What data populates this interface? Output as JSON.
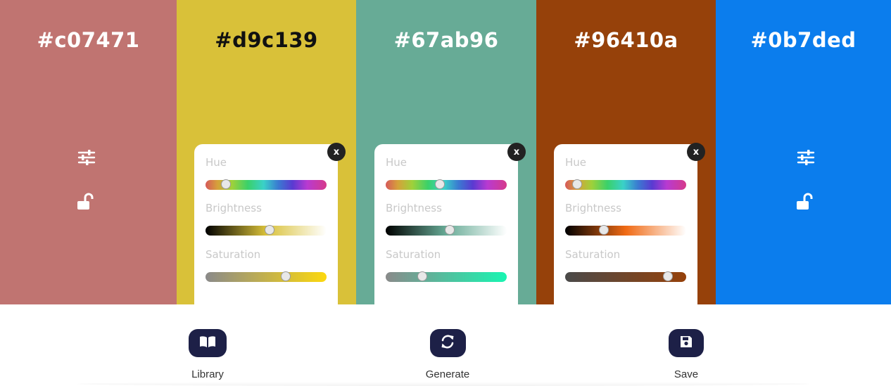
{
  "palette": {
    "columns": [
      {
        "hex": "#c07471",
        "bg": "#c07471",
        "text_color": "#ffffff",
        "state": "collapsed",
        "adjust_icon": "sliders-icon",
        "lock_icon": "unlock-icon",
        "locked": false
      },
      {
        "hex": "#d9c139",
        "bg": "#d9c139",
        "text_color": "#111111",
        "state": "adjusting",
        "panel": {
          "hue_label": "Hue",
          "brightness_label": "Brightness",
          "saturation_label": "Saturation",
          "close_label": "x",
          "hue_value": 0.17,
          "brightness_value": 0.53,
          "saturation_value": 0.66,
          "brightness_colors": [
            "#000000",
            "#d9c139",
            "#ffffff"
          ],
          "saturation_colors": [
            "#8a8a8a",
            "#fcd80f"
          ]
        }
      },
      {
        "hex": "#67ab96",
        "bg": "#67ab96",
        "text_color": "#ffffff",
        "state": "adjusting",
        "panel": {
          "hue_label": "Hue",
          "brightness_label": "Brightness",
          "saturation_label": "Saturation",
          "close_label": "x",
          "hue_value": 0.45,
          "brightness_value": 0.53,
          "saturation_value": 0.3,
          "brightness_colors": [
            "#000000",
            "#67ab96",
            "#ffffff"
          ],
          "saturation_colors": [
            "#8a8a8a",
            "#19f5b2"
          ]
        }
      },
      {
        "hex": "#96410a",
        "bg": "#96410a",
        "text_color": "#ffffff",
        "state": "adjusting",
        "panel": {
          "hue_label": "Hue",
          "brightness_label": "Brightness",
          "saturation_label": "Saturation",
          "close_label": "x",
          "hue_value": 0.1,
          "brightness_value": 0.32,
          "saturation_value": 0.85,
          "brightness_colors": [
            "#000000",
            "#f06a14",
            "#ffffff"
          ],
          "saturation_colors": [
            "#4a4a4a",
            "#96410a"
          ]
        }
      },
      {
        "hex": "#0b7ded",
        "bg": "#0b7ded",
        "text_color": "#ffffff",
        "state": "collapsed",
        "adjust_icon": "sliders-icon",
        "lock_icon": "unlock-icon",
        "locked": false
      }
    ]
  },
  "toolbar": {
    "library_label": "Library",
    "library_icon": "book-icon",
    "generate_label": "Generate",
    "generate_icon": "refresh-icon",
    "save_label": "Save",
    "save_icon": "floppy-disk-icon",
    "button_color": "#1d2047"
  }
}
